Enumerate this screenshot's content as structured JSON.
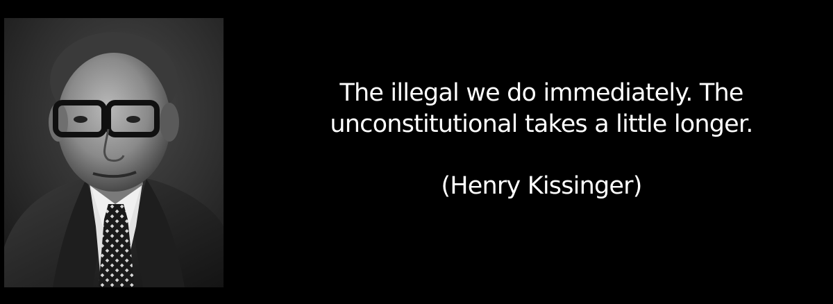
{
  "quote": {
    "lines": [
      "The illegal we do immediately. The",
      "unconstitutional takes a little longer."
    ],
    "attribution": "(Henry Kissinger)"
  },
  "colors": {
    "background": "#000000",
    "text": "#ffffff",
    "photo_background": "#2a2a2a"
  }
}
